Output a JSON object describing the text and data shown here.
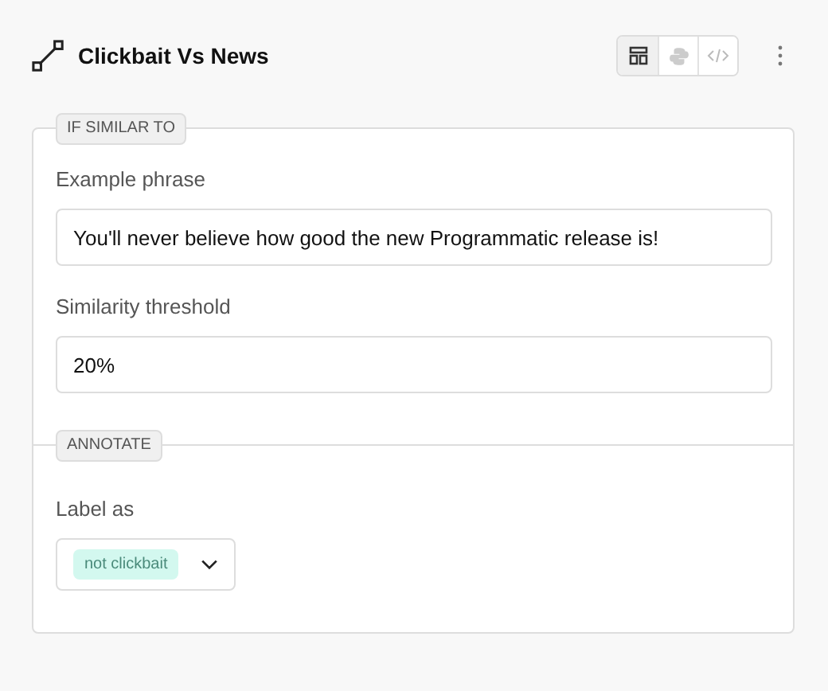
{
  "header": {
    "title": "Clickbait Vs News"
  },
  "view_buttons": [
    {
      "kind": "layout",
      "selected": true
    },
    {
      "kind": "python",
      "selected": false
    },
    {
      "kind": "code",
      "selected": false
    }
  ],
  "sections": [
    {
      "legend": "IF SIMILAR TO",
      "fields": [
        {
          "kind": "text",
          "label": "Example phrase",
          "value": "You'll never believe how good the new Programmatic release is!"
        },
        {
          "kind": "text",
          "label": "Similarity threshold",
          "value": "20%"
        }
      ]
    },
    {
      "legend": "ANNOTATE",
      "fields": [
        {
          "kind": "select",
          "label": "Label as",
          "value": "not clickbait",
          "color": "#d3f8ef"
        }
      ]
    }
  ]
}
